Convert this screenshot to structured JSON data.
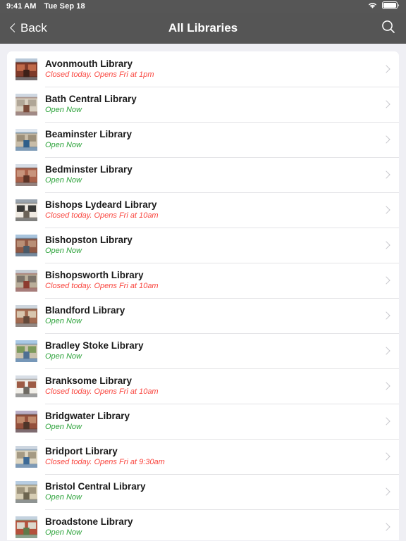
{
  "status_bar": {
    "time": "9:41 AM",
    "date": "Tue Sep 18",
    "wifi_icon": "wifi-icon",
    "battery_icon": "battery-full-icon"
  },
  "nav_bar": {
    "back_label": "Back",
    "back_icon": "chevron-left-icon",
    "title": "All Libraries",
    "search_icon": "search-icon"
  },
  "colors": {
    "nav_background": "#555555",
    "status_background": "#565656",
    "page_background": "#efeff4",
    "card_background": "#ffffff",
    "open_text": "#2ba239",
    "closed_text": "#f9453e",
    "separator": "#e3e3e6",
    "chevron": "#c7c7cc"
  },
  "list": {
    "rows": [
      {
        "name": "Avonmouth Library",
        "status": "Closed today. Opens Fri at 1pm",
        "state": "closed",
        "thumb": "brick-chapel-library-photo",
        "c1": "#7e3a2a",
        "c2": "#c06a4a",
        "c3": "#3d2018",
        "sky": "#b8c8d8"
      },
      {
        "name": "Bath Central Library",
        "status": "Open Now",
        "state": "open",
        "thumb": "stone-street-frontage-photo",
        "c1": "#d8cfc0",
        "c2": "#b0a697",
        "c3": "#7a4b3a",
        "sky": "#cfd8e2"
      },
      {
        "name": "Beaminster Library",
        "status": "Open Now",
        "state": "open",
        "thumb": "stone-cottage-blue-door-photo",
        "c1": "#c9bda8",
        "c2": "#9c8f79",
        "c3": "#2f5f8a",
        "sky": "#dfe6ee"
      },
      {
        "name": "Bedminster Library",
        "status": "Open Now",
        "state": "open",
        "thumb": "red-brick-terrace-photo",
        "c1": "#a9614a",
        "c2": "#c8947c",
        "c3": "#5d3427",
        "sky": "#d6dde6"
      },
      {
        "name": "Bishops Lydeard Library",
        "status": "Closed today. Opens Fri at 10am",
        "state": "closed",
        "thumb": "white-shopfront-photo",
        "c1": "#efeae2",
        "c2": "#3a3a38",
        "c3": "#6b6358",
        "sky": "#9aa4ae"
      },
      {
        "name": "Bishopston Library",
        "status": "Open Now",
        "state": "open",
        "thumb": "modern-brick-building-photo",
        "c1": "#8f5844",
        "c2": "#b98f76",
        "c3": "#4a5a68",
        "sky": "#a8c4dd"
      },
      {
        "name": "Bishopsworth Library",
        "status": "Closed today. Opens Fri at 10am",
        "state": "closed",
        "thumb": "low-roadside-building-photo",
        "c1": "#b9ae9a",
        "c2": "#7c746a",
        "c3": "#8d3b30",
        "sky": "#c6cdd4"
      },
      {
        "name": "Blandford Library",
        "status": "Open Now",
        "state": "open",
        "thumb": "brick-terrace-street-photo",
        "c1": "#a26a50",
        "c2": "#d8c6ae",
        "c3": "#63493a",
        "sky": "#cdd5dd"
      },
      {
        "name": "Bradley Stoke Library",
        "status": "Open Now",
        "state": "open",
        "thumb": "modern-civic-centre-photo",
        "c1": "#c9c1ad",
        "c2": "#7d9a5c",
        "c3": "#4d6f93",
        "sky": "#a9c8e4"
      },
      {
        "name": "Branksome Library",
        "status": "Closed today. Opens Fri at 10am",
        "state": "closed",
        "thumb": "white-gabled-building-photo",
        "c1": "#f1efe9",
        "c2": "#9d5b45",
        "c3": "#6e6a63",
        "sky": "#d8dee6"
      },
      {
        "name": "Bridgwater Library",
        "status": "Open Now",
        "state": "open",
        "thumb": "red-brick-library-photo",
        "c1": "#94503c",
        "c2": "#c08a6c",
        "c3": "#4e3529",
        "sky": "#b9aec6"
      },
      {
        "name": "Bridport Library",
        "status": "Closed today. Opens Fri at 9:30am",
        "state": "closed",
        "thumb": "pale-stone-building-photo",
        "c1": "#ded6c2",
        "c2": "#a59a83",
        "c3": "#3d6a96",
        "sky": "#cdd6e0"
      },
      {
        "name": "Bristol Central Library",
        "status": "Open Now",
        "state": "open",
        "thumb": "grand-stone-library-photo",
        "c1": "#d6cdb4",
        "c2": "#9e947c",
        "c3": "#6d6550",
        "sky": "#b7cde2"
      },
      {
        "name": "Broadstone Library",
        "status": "Open Now",
        "state": "open",
        "thumb": "single-storey-red-roof-photo",
        "c1": "#b4513c",
        "c2": "#dcd8cc",
        "c3": "#5f7a4a",
        "sky": "#c4d2df"
      }
    ]
  }
}
